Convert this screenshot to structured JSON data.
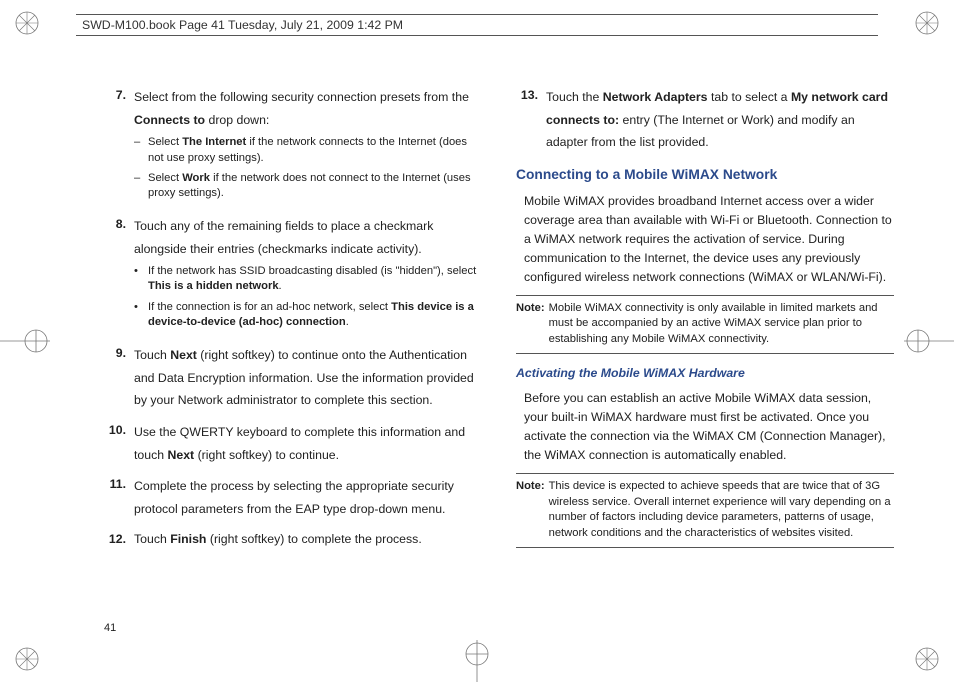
{
  "header": {
    "running": "SWD-M100.book  Page 41  Tuesday, July 21, 2009  1:42 PM"
  },
  "page_number": "41",
  "left": {
    "steps": [
      {
        "n": "7.",
        "text_a": "Select from the following security connection presets from the ",
        "bold_a": "Connects to",
        "text_b": " drop down:",
        "dashes": [
          {
            "a": "Select ",
            "b": "The Internet",
            "c": " if the network connects to the Internet (does not use proxy settings)."
          },
          {
            "a": "Select ",
            "b": "Work",
            "c": " if the network does not connect to the Internet (uses proxy settings)."
          }
        ]
      },
      {
        "n": "8.",
        "text": "Touch any of the remaining fields to place a checkmark alongside their entries (checkmarks indicate activity).",
        "bullets": [
          {
            "a": "If the network has SSID broadcasting disabled (is \"hidden\"), select ",
            "b": "This is a hidden network",
            "c": "."
          },
          {
            "a": "If the connection is for an ad-hoc network, select ",
            "b": "This device is a device-to-device (ad-hoc) connection",
            "c": "."
          }
        ]
      },
      {
        "n": "9.",
        "pre": "Touch ",
        "bold": "Next",
        "post": " (right softkey) to continue onto the Authentication and Data Encryption information. Use the information provided by your Network administrator to complete this section."
      },
      {
        "n": "10.",
        "pre": "Use the QWERTY keyboard to complete this information and touch ",
        "bold": "Next",
        "post": " (right softkey) to continue."
      },
      {
        "n": "11.",
        "text": "Complete the process by selecting the appropriate security protocol parameters from the EAP type drop-down menu."
      },
      {
        "n": "12.",
        "pre": "Touch ",
        "bold": "Finish",
        "post": " (right softkey) to complete the process."
      }
    ]
  },
  "right": {
    "step13": {
      "n": "13.",
      "a": "Touch the ",
      "b": "Network Adapters",
      "c": " tab to select a ",
      "d": "My network card connects to:",
      "e": " entry (The Internet or Work) and modify an adapter from the list provided."
    },
    "h2": "Connecting to a Mobile WiMAX Network",
    "p1": "Mobile WiMAX provides broadband Internet access over a wider coverage area than available with Wi-Fi or Bluetooth. Connection to a WiMAX network requires the activation of service. During communication to the Internet, the device uses any previously configured wireless network connections (WiMAX or WLAN/Wi-Fi).",
    "note1_label": "Note:",
    "note1": "Mobile WiMAX connectivity is only available in limited markets and must be accompanied by an active WiMAX service plan prior to establishing any Mobile WiMAX connectivity.",
    "h3": "Activating the Mobile WiMAX Hardware",
    "p2": "Before you can establish an active Mobile WiMAX data session, your built-in WiMAX hardware must first be activated. Once you activate the connection via the WiMAX CM (Connection Manager), the WiMAX connection is automatically enabled.",
    "note2_label": "Note:",
    "note2": "This device is expected to achieve speeds that are twice that of 3G wireless service. Overall internet experience will vary depending on a number of factors including device parameters, patterns of usage, network conditions and the characteristics of websites visited."
  }
}
